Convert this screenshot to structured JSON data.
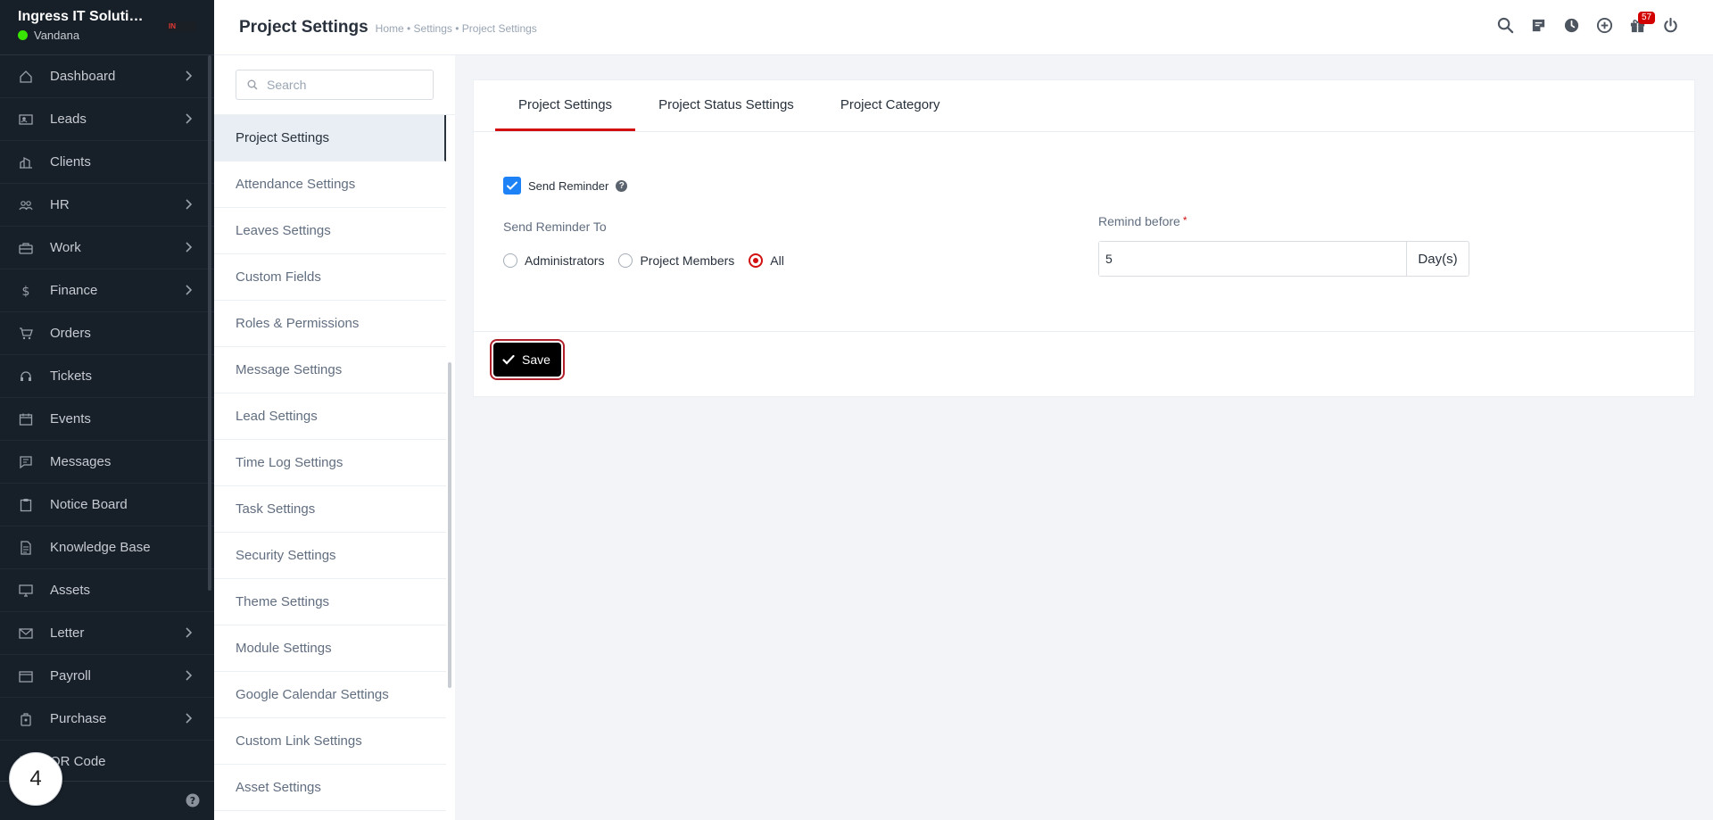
{
  "sidebar": {
    "company": "Ingress IT Soluti…",
    "user_name": "Vandana",
    "items": [
      {
        "label": "Dashboard",
        "icon": "house-icon",
        "has_submenu": true
      },
      {
        "label": "Leads",
        "icon": "person-card-icon",
        "has_submenu": true
      },
      {
        "label": "Clients",
        "icon": "building-icon",
        "has_submenu": false
      },
      {
        "label": "HR",
        "icon": "people-icon",
        "has_submenu": true
      },
      {
        "label": "Work",
        "icon": "briefcase-icon",
        "has_submenu": true
      },
      {
        "label": "Finance",
        "icon": "dollar-icon",
        "has_submenu": true
      },
      {
        "label": "Orders",
        "icon": "cart-icon",
        "has_submenu": false
      },
      {
        "label": "Tickets",
        "icon": "headset-icon",
        "has_submenu": false
      },
      {
        "label": "Events",
        "icon": "calendar-icon",
        "has_submenu": false
      },
      {
        "label": "Messages",
        "icon": "chat-icon",
        "has_submenu": false
      },
      {
        "label": "Notice Board",
        "icon": "clipboard-icon",
        "has_submenu": false
      },
      {
        "label": "Knowledge Base",
        "icon": "document-icon",
        "has_submenu": false
      },
      {
        "label": "Assets",
        "icon": "monitor-icon",
        "has_submenu": false
      },
      {
        "label": "Letter",
        "icon": "envelope-icon",
        "has_submenu": true
      },
      {
        "label": "Payroll",
        "icon": "wallet-icon",
        "has_submenu": true
      },
      {
        "label": "Purchase",
        "icon": "bag-icon",
        "has_submenu": true
      },
      {
        "label": "QR Code",
        "icon": "qr-icon",
        "has_submenu": false
      }
    ],
    "step_number": "4"
  },
  "header": {
    "title": "Project Settings",
    "breadcrumb": "Home • Settings • Project Settings",
    "notification_count": "57"
  },
  "settings_menu": {
    "search_placeholder": "Search",
    "items": [
      "Project Settings",
      "Attendance Settings",
      "Leaves Settings",
      "Custom Fields",
      "Roles & Permissions",
      "Message Settings",
      "Lead Settings",
      "Time Log Settings",
      "Task Settings",
      "Security Settings",
      "Theme Settings",
      "Module Settings",
      "Google Calendar Settings",
      "Custom Link Settings",
      "Asset Settings"
    ],
    "active_index": 0
  },
  "main": {
    "tabs": [
      "Project Settings",
      "Project Status Settings",
      "Project Category"
    ],
    "active_tab": 0,
    "send_reminder_label": "Send Reminder",
    "send_reminder_checked": true,
    "send_reminder_to_label": "Send Reminder To",
    "radio_options": [
      "Administrators",
      "Project Members",
      "All"
    ],
    "radio_selected": 2,
    "remind_before_label": "Remind before",
    "remind_before_value": "5",
    "remind_before_unit": "Day(s)",
    "save_label": "Save"
  },
  "colors": {
    "sidebar_bg": "#171f29",
    "accent_red": "#d21010",
    "checkbox_blue": "#1d82f5",
    "save_bg": "#000000"
  }
}
